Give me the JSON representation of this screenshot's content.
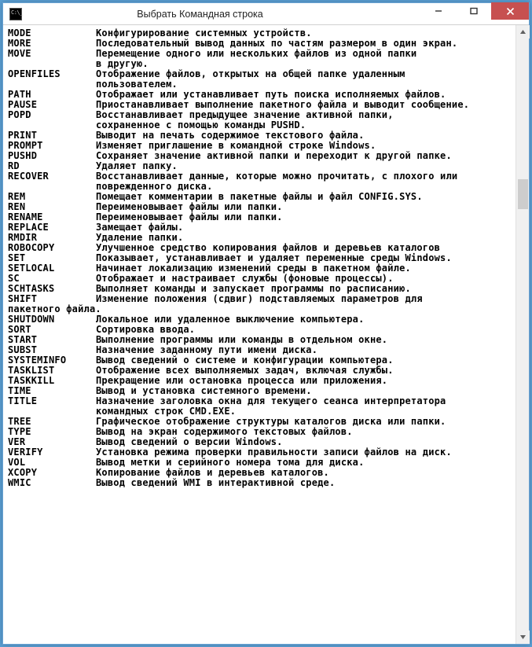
{
  "window": {
    "title": "Выбрать Командная строка"
  },
  "lines": [
    {
      "cmd": "MODE",
      "desc": "Конфигурирование системных устройств."
    },
    {
      "cmd": "MORE",
      "desc": "Последовательный вывод данных по частям размером в один экран."
    },
    {
      "cmd": "MOVE",
      "desc": "Перемещение одного или нескольких файлов из одной папки"
    },
    {
      "cmd": "",
      "desc": "в другую."
    },
    {
      "cmd": "OPENFILES",
      "desc": "Отображение файлов, открытых на общей папке удаленным"
    },
    {
      "cmd": "",
      "desc": "пользователем."
    },
    {
      "cmd": "PATH",
      "desc": "Отображает или устанавливает путь поиска исполняемых файлов."
    },
    {
      "cmd": "PAUSE",
      "desc": "Приостанавливает выполнение пакетного файла и выводит сообщение."
    },
    {
      "cmd": "POPD",
      "desc": "Восстанавливает предыдущее значение активной папки,"
    },
    {
      "cmd": "",
      "desc": "сохраненное с помощью команды PUSHD."
    },
    {
      "cmd": "PRINT",
      "desc": "Выводит на печать содержимое текстового файла."
    },
    {
      "cmd": "PROMPT",
      "desc": "Изменяет приглашение в командной строке Windows."
    },
    {
      "cmd": "PUSHD",
      "desc": "Сохраняет значение активной папки и переходит к другой папке."
    },
    {
      "cmd": "RD",
      "desc": "Удаляет папку."
    },
    {
      "cmd": "RECOVER",
      "desc": "Восстанавливает данные, которые можно прочитать, с плохого или"
    },
    {
      "cmd": "",
      "desc": "поврежденного диска."
    },
    {
      "cmd": "REM",
      "desc": "Помещает комментарии в пакетные файлы и файл CONFIG.SYS."
    },
    {
      "cmd": "REN",
      "desc": "Переименовывает файлы или папки."
    },
    {
      "cmd": "RENAME",
      "desc": "Переименовывает файлы или папки."
    },
    {
      "cmd": "REPLACE",
      "desc": "Замещает файлы."
    },
    {
      "cmd": "RMDIR",
      "desc": "Удаление папки."
    },
    {
      "cmd": "ROBOCOPY",
      "desc": "Улучшенное средство копирования файлов и деревьев каталогов"
    },
    {
      "cmd": "SET",
      "desc": "Показывает, устанавливает и удаляет переменные среды Windows."
    },
    {
      "cmd": "SETLOCAL",
      "desc": "Начинает локализацию изменений среды в пакетном файле."
    },
    {
      "cmd": "SC",
      "desc": "Отображает и настраивает службы (фоновые процессы)."
    },
    {
      "cmd": "SCHTASKS",
      "desc": "Выполняет команды и запускает программы по расписанию."
    },
    {
      "cmd": "SHIFT",
      "desc": "Изменение положения (сдвиг) подставляемых параметров для"
    },
    {
      "wrap": "пакетного файла."
    },
    {
      "cmd": "SHUTDOWN",
      "desc": "Локальное или удаленное выключение компьютера."
    },
    {
      "cmd": "SORT",
      "desc": "Сортировка ввода."
    },
    {
      "cmd": "START",
      "desc": "Выполнение программы или команды в отдельном окне."
    },
    {
      "cmd": "SUBST",
      "desc": "Назначение заданному пути имени диска."
    },
    {
      "cmd": "SYSTEMINFO",
      "desc": "Вывод сведений о системе и конфигурации компьютера."
    },
    {
      "cmd": "TASKLIST",
      "desc": "Отображение всех выполняемых задач, включая службы."
    },
    {
      "cmd": "TASKKILL",
      "desc": "Прекращение или остановка процесса или приложения."
    },
    {
      "cmd": "TIME",
      "desc": "Вывод и установка системного времени."
    },
    {
      "cmd": "TITLE",
      "desc": "Назначение заголовка окна для текущего сеанса интерпретатора"
    },
    {
      "cmd": "",
      "desc": "командных строк CMD.EXE."
    },
    {
      "cmd": "TREE",
      "desc": "Графическое отображение структуры каталогов диска или папки."
    },
    {
      "wrap": ""
    },
    {
      "cmd": "TYPE",
      "desc": "Вывод на экран содержимого текстовых файлов."
    },
    {
      "cmd": "VER",
      "desc": "Вывод сведений о версии Windows."
    },
    {
      "cmd": "VERIFY",
      "desc": "Установка режима проверки правильности записи файлов на диск."
    },
    {
      "wrap": ""
    },
    {
      "cmd": "VOL",
      "desc": "Вывод метки и серийного номера тома для диска."
    },
    {
      "cmd": "XCOPY",
      "desc": "Копирование файлов и деревьев каталогов."
    },
    {
      "cmd": "WMIC",
      "desc": "Вывод сведений WMI в интерактивной среде."
    }
  ]
}
